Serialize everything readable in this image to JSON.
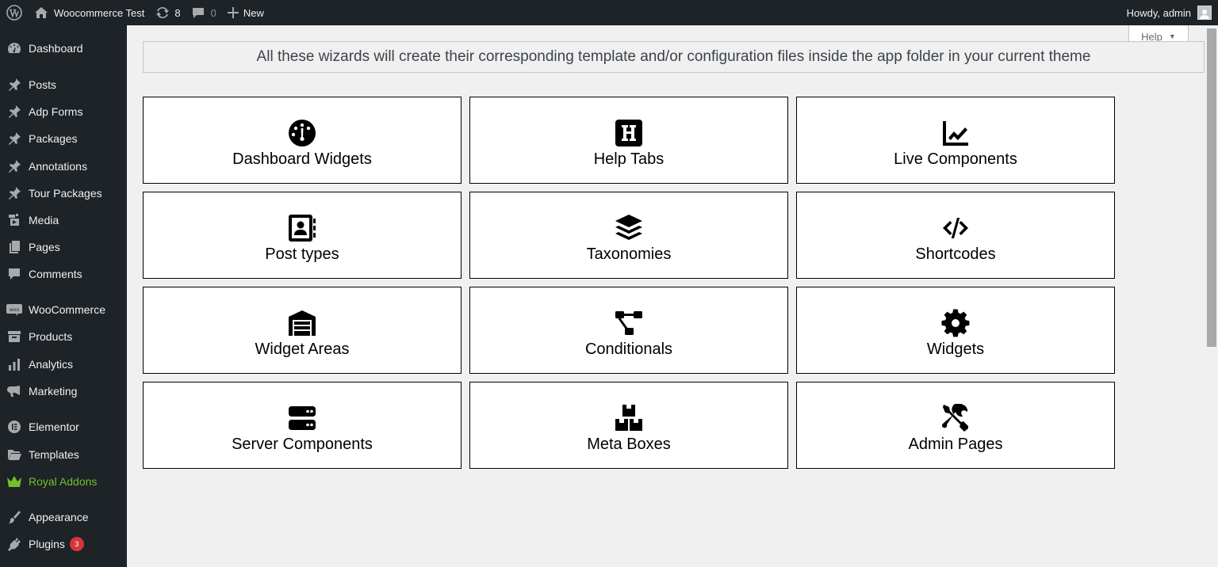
{
  "admin_bar": {
    "site_name": "Woocommerce Test",
    "updates_count": "8",
    "comments_count": "0",
    "new_label": "New",
    "greeting": "Howdy, admin"
  },
  "sidebar": {
    "items": [
      {
        "label": "Dashboard",
        "icon": "dashboard-icon"
      },
      {
        "label": "Posts",
        "icon": "pin-icon"
      },
      {
        "label": "Adp Forms",
        "icon": "pin-icon"
      },
      {
        "label": "Packages",
        "icon": "pin-icon"
      },
      {
        "label": "Annotations",
        "icon": "pin-icon"
      },
      {
        "label": "Tour Packages",
        "icon": "pin-icon"
      },
      {
        "label": "Media",
        "icon": "media-icon"
      },
      {
        "label": "Pages",
        "icon": "pages-icon"
      },
      {
        "label": "Comments",
        "icon": "comment-icon"
      },
      {
        "label": "WooCommerce",
        "icon": "woo-icon"
      },
      {
        "label": "Products",
        "icon": "archive-icon"
      },
      {
        "label": "Analytics",
        "icon": "bar-chart-icon"
      },
      {
        "label": "Marketing",
        "icon": "megaphone-icon"
      },
      {
        "label": "Elementor",
        "icon": "elementor-icon"
      },
      {
        "label": "Templates",
        "icon": "folder-icon"
      },
      {
        "label": "Royal Addons",
        "icon": "crown-icon",
        "color": "#72c02c"
      },
      {
        "label": "Appearance",
        "icon": "brush-icon"
      },
      {
        "label": "Plugins",
        "icon": "plug-icon",
        "badge": "3"
      }
    ]
  },
  "help_tab": {
    "label": "Help",
    "caret": "▼"
  },
  "notice": "All these wizards will create their corresponding template and/or configuration files inside the app folder in your current theme",
  "wizards": [
    {
      "label": "Dashboard Widgets",
      "icon": "gauge-icon"
    },
    {
      "label": "Help Tabs",
      "icon": "h-square-icon"
    },
    {
      "label": "Live Components",
      "icon": "line-chart-icon"
    },
    {
      "label": "Post types",
      "icon": "address-book-icon"
    },
    {
      "label": "Taxonomies",
      "icon": "layers-icon"
    },
    {
      "label": "Shortcodes",
      "icon": "code-icon"
    },
    {
      "label": "Widget Areas",
      "icon": "warehouse-icon"
    },
    {
      "label": "Conditionals",
      "icon": "diagram-icon"
    },
    {
      "label": "Widgets",
      "icon": "gear-icon"
    },
    {
      "label": "Server Components",
      "icon": "server-icon"
    },
    {
      "label": "Meta Boxes",
      "icon": "boxes-icon"
    },
    {
      "label": "Admin Pages",
      "icon": "tools-icon"
    }
  ]
}
